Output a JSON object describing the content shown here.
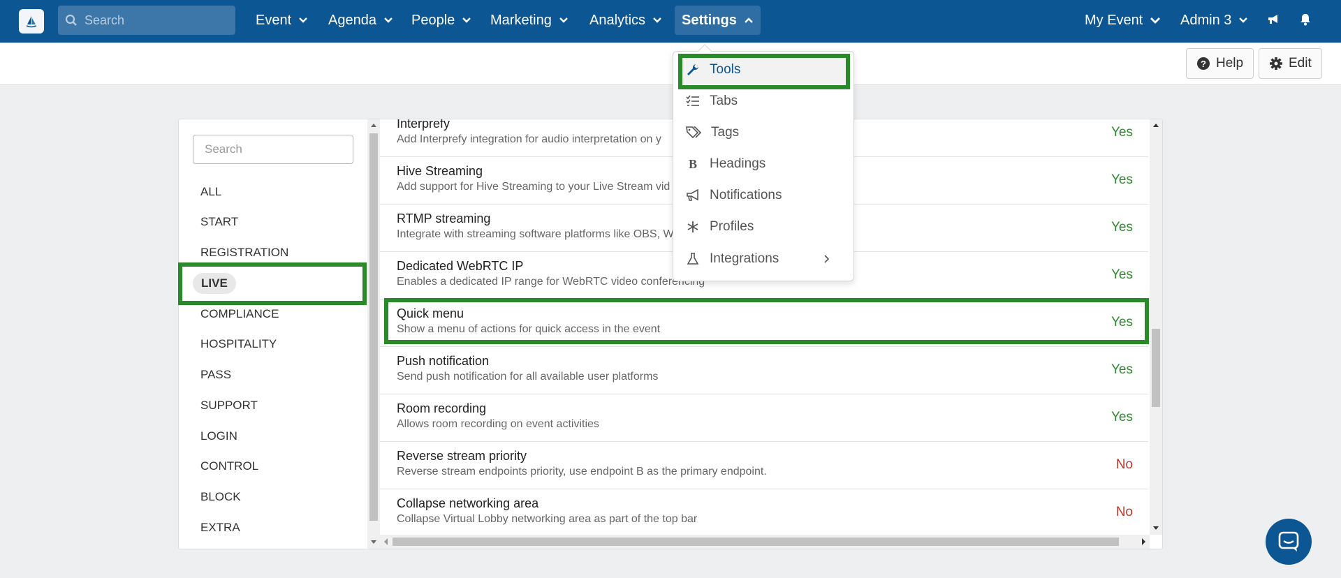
{
  "nav": {
    "search_placeholder": "Search",
    "items": [
      {
        "label": "Event"
      },
      {
        "label": "Agenda"
      },
      {
        "label": "People"
      },
      {
        "label": "Marketing"
      },
      {
        "label": "Analytics"
      },
      {
        "label": "Settings",
        "active": true
      }
    ],
    "right": {
      "event": "My Event",
      "user": "Admin 3"
    }
  },
  "subbar": {
    "help": "Help",
    "edit": "Edit"
  },
  "sidebar": {
    "search_placeholder": "Search",
    "items": [
      "ALL",
      "START",
      "REGISTRATION",
      "LIVE",
      "COMPLIANCE",
      "HOSPITALITY",
      "PASS",
      "SUPPORT",
      "LOGIN",
      "CONTROL",
      "BLOCK",
      "EXTRA"
    ],
    "active": "LIVE"
  },
  "settings_list": [
    {
      "title": "Interprefy",
      "desc": "Add Interprefy integration for audio interpretation on y",
      "value": "Yes"
    },
    {
      "title": "Hive Streaming",
      "desc": "Add support for Hive Streaming to your Live Stream vid",
      "value": "Yes"
    },
    {
      "title": "RTMP streaming",
      "desc": "Integrate with streaming software platforms like OBS, W",
      "value": "Yes"
    },
    {
      "title": "Dedicated WebRTC IP",
      "desc": "Enables a dedicated IP range for WebRTC video conferencing",
      "value": "Yes"
    },
    {
      "title": "Quick menu",
      "desc": "Show a menu of actions for quick access in the event",
      "value": "Yes"
    },
    {
      "title": "Push notification",
      "desc": "Send push notification for all available user platforms",
      "value": "Yes"
    },
    {
      "title": "Room recording",
      "desc": "Allows room recording on event activities",
      "value": "Yes"
    },
    {
      "title": "Reverse stream priority",
      "desc": "Reverse stream endpoints priority, use endpoint B as the primary endpoint.",
      "value": "No"
    },
    {
      "title": "Collapse networking area",
      "desc": "Collapse Virtual Lobby networking area as part of the top bar",
      "value": "No"
    }
  ],
  "settings_dropdown": {
    "items": [
      {
        "label": "Tools",
        "icon": "wrench-icon"
      },
      {
        "label": "Tabs",
        "icon": "list-check-icon"
      },
      {
        "label": "Tags",
        "icon": "tags-icon"
      },
      {
        "label": "Headings",
        "icon": "bold-icon"
      },
      {
        "label": "Notifications",
        "icon": "megaphone-icon"
      },
      {
        "label": "Profiles",
        "icon": "asterisk-icon"
      },
      {
        "label": "Integrations",
        "icon": "flask-icon"
      }
    ]
  },
  "colors": {
    "nav_bg": "#0c5694",
    "highlight": "#2a8a2a",
    "yes": "#2f8a2f",
    "no": "#c0392b"
  }
}
